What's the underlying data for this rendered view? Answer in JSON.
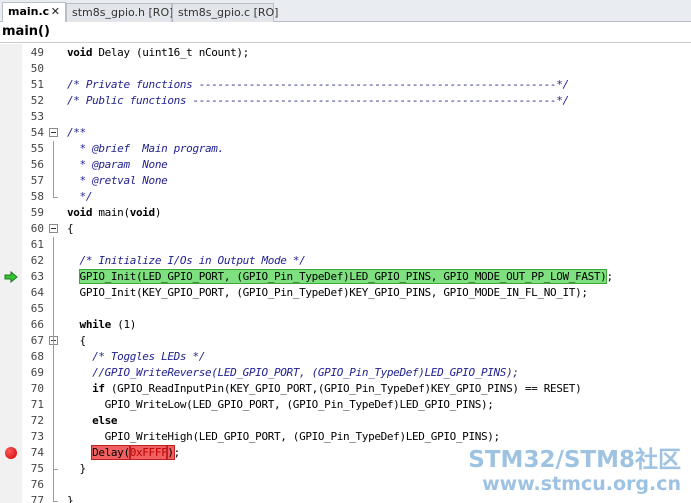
{
  "tabs": [
    {
      "label": "main.c",
      "close": "✕",
      "active": true
    },
    {
      "label": "stm8s_gpio.h [RO]"
    },
    {
      "label": "stm8s_gpio.c [RO]"
    }
  ],
  "function_bar": {
    "label": "main()"
  },
  "code_lines": [
    {
      "num": "49",
      "segments": [
        {
          "t": "void",
          "c": "kw"
        },
        {
          "t": " Delay (uint16_t nCount);"
        }
      ]
    },
    {
      "num": "50",
      "segments": []
    },
    {
      "num": "51",
      "segments": [
        {
          "t": "/* Private functions ---------------------------------------------------------*/",
          "c": "cm"
        }
      ]
    },
    {
      "num": "52",
      "segments": [
        {
          "t": "/* Public functions ----------------------------------------------------------*/",
          "c": "cm"
        }
      ]
    },
    {
      "num": "53",
      "segments": []
    },
    {
      "num": "54",
      "fold": "open",
      "segments": [
        {
          "t": "/**",
          "c": "cm"
        }
      ]
    },
    {
      "num": "55",
      "segments": [
        {
          "t": "  * @brief  Main program.",
          "c": "cm"
        }
      ]
    },
    {
      "num": "56",
      "segments": [
        {
          "t": "  * @param  None",
          "c": "cm"
        }
      ]
    },
    {
      "num": "57",
      "segments": [
        {
          "t": "  * @retval None",
          "c": "cm"
        }
      ]
    },
    {
      "num": "58",
      "segments": [
        {
          "t": "  */",
          "c": "cm"
        }
      ]
    },
    {
      "num": "59",
      "segments": [
        {
          "t": "void",
          "c": "kw"
        },
        {
          "t": " main("
        },
        {
          "t": "void",
          "c": "kw"
        },
        {
          "t": ")"
        }
      ]
    },
    {
      "num": "60",
      "fold": "open",
      "segments": [
        {
          "t": "{"
        }
      ]
    },
    {
      "num": "61",
      "segments": []
    },
    {
      "num": "62",
      "segments": [
        {
          "t": "  "
        },
        {
          "t": "/* Initialize I/Os in Output Mode */",
          "c": "cm"
        }
      ]
    },
    {
      "num": "63",
      "marker": "arrow",
      "segments": [
        {
          "t": "  "
        },
        {
          "t": "GPIO_Init(LED_GPIO_PORT, (GPIO_Pin_TypeDef)LED_GPIO_PINS, GPIO_MODE_OUT_PP_LOW_FAST)",
          "c": "hl-green"
        },
        {
          "t": ";"
        }
      ]
    },
    {
      "num": "64",
      "segments": [
        {
          "t": "  GPIO_Init(KEY_GPIO_PORT, (GPIO_Pin_TypeDef)KEY_GPIO_PINS, GPIO_MODE_IN_FL_NO_IT);"
        }
      ]
    },
    {
      "num": "65",
      "segments": []
    },
    {
      "num": "66",
      "segments": [
        {
          "t": "  "
        },
        {
          "t": "while",
          "c": "kw"
        },
        {
          "t": " (1)"
        }
      ]
    },
    {
      "num": "67",
      "fold": "open",
      "segments": [
        {
          "t": "  {"
        }
      ]
    },
    {
      "num": "68",
      "segments": [
        {
          "t": "    "
        },
        {
          "t": "/* Toggles LEDs */",
          "c": "cm"
        }
      ]
    },
    {
      "num": "69",
      "segments": [
        {
          "t": "    "
        },
        {
          "t": "//GPIO_WriteReverse(LED_GPIO_PORT, (GPIO_Pin_TypeDef)LED_GPIO_PINS);",
          "c": "cm"
        }
      ]
    },
    {
      "num": "70",
      "segments": [
        {
          "t": "    "
        },
        {
          "t": "if",
          "c": "kw"
        },
        {
          "t": " (GPIO_ReadInputPin(KEY_GPIO_PORT,(GPIO_Pin_TypeDef)KEY_GPIO_PINS) == RESET)"
        }
      ]
    },
    {
      "num": "71",
      "segments": [
        {
          "t": "      GPIO_WriteLow(LED_GPIO_PORT, (GPIO_Pin_TypeDef)LED_GPIO_PINS);"
        }
      ]
    },
    {
      "num": "72",
      "segments": [
        {
          "t": "    "
        },
        {
          "t": "else",
          "c": "kw"
        }
      ]
    },
    {
      "num": "73",
      "segments": [
        {
          "t": "      GPIO_WriteHigh(LED_GPIO_PORT, (GPIO_Pin_TypeDef)LED_GPIO_PINS);"
        }
      ]
    },
    {
      "num": "74",
      "marker": "breakpoint",
      "segments": [
        {
          "t": "    "
        },
        {
          "t": "Delay(",
          "c": "hl-red"
        },
        {
          "t": "0xFFFF",
          "c": "hl-red num"
        },
        {
          "t": ")",
          "c": "hl-red"
        },
        {
          "t": ";"
        }
      ]
    },
    {
      "num": "75",
      "fold": "end",
      "segments": [
        {
          "t": "  }"
        }
      ]
    },
    {
      "num": "76",
      "segments": []
    },
    {
      "num": "77",
      "fold": "end",
      "segments": [
        {
          "t": "}"
        }
      ]
    }
  ],
  "watermark": {
    "line1": "STM32/STM8社区",
    "line2": "www.stmcu.org.cn"
  },
  "colors": {
    "exec_highlight": "#7fe07f",
    "breakpoint_highlight": "#f06060",
    "breakpoint_marker": "#d00000"
  }
}
